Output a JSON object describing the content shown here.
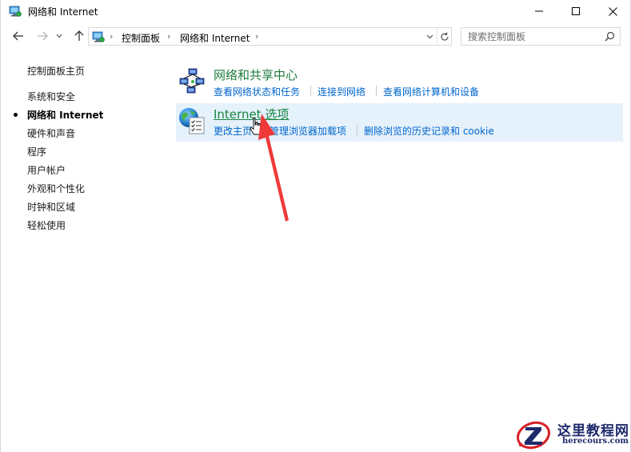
{
  "window": {
    "title": "网络和 Internet"
  },
  "navigation": {
    "breadcrumbs": [
      "控制面板",
      "网络和 Internet"
    ]
  },
  "search": {
    "placeholder": "搜索控制面板"
  },
  "sidebar": {
    "items": [
      {
        "label": "控制面板主页",
        "active": false
      },
      {
        "label": "系统和安全",
        "active": false
      },
      {
        "label": "网络和 Internet",
        "active": true
      },
      {
        "label": "硬件和声音",
        "active": false
      },
      {
        "label": "程序",
        "active": false
      },
      {
        "label": "用户帐户",
        "active": false
      },
      {
        "label": "外观和个性化",
        "active": false
      },
      {
        "label": "时钟和区域",
        "active": false
      },
      {
        "label": "轻松使用",
        "active": false
      }
    ]
  },
  "categories": [
    {
      "title": "网络和共享中心",
      "icon": "network-sharing-icon",
      "links": [
        "查看网络状态和任务",
        "连接到网络",
        "查看网络计算机和设备"
      ]
    },
    {
      "title": "Internet 选项",
      "icon": "internet-options-icon",
      "highlighted": true,
      "links": [
        "更改主页",
        "管理浏览器加载项",
        "删除浏览的历史记录和 cookie"
      ]
    }
  ],
  "colors": {
    "category_title": "#1e7b3a",
    "link": "#0066cc",
    "highlight_bg": "#e5f1fb",
    "annotation_arrow": "#f03a3a"
  },
  "watermark": {
    "title": "这里教程网",
    "url": "herecours.com"
  }
}
